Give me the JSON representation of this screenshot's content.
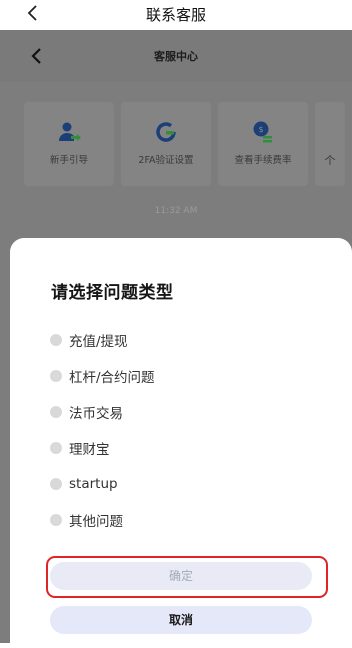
{
  "header": {
    "title": "联系客服",
    "back_icon": "chevron-left-icon"
  },
  "webview": {
    "title": "客服中心",
    "back_icon": "chevron-left-icon",
    "cards": [
      {
        "label": "新手引导",
        "icon": "user-arrow-icon"
      },
      {
        "label": "2FA验证设置",
        "icon": "refresh-g-icon"
      },
      {
        "label": "查看手续费率",
        "icon": "fee-coin-icon"
      },
      {
        "label": "个",
        "icon": ""
      }
    ],
    "time": "11:32 AM"
  },
  "sheet": {
    "title": "请选择问题类型",
    "options": [
      "充值/提现",
      "杠杆/合约问题",
      "法币交易",
      "理财宝",
      "startup",
      "其他问题"
    ],
    "confirm_label": "确定",
    "cancel_label": "取消"
  },
  "colors": {
    "highlight": "#e02424",
    "icon_blue": "#1a4fa0",
    "icon_green": "#3cb44a"
  }
}
